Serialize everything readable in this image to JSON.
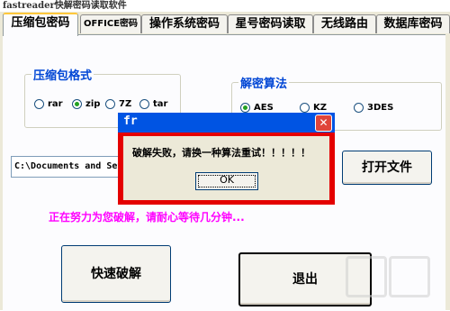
{
  "window": {
    "title": "fastreader快解密码读取软件"
  },
  "tabs": [
    {
      "label": "压缩包密码",
      "active": true
    },
    {
      "label": "OFFICE密码",
      "active": false
    },
    {
      "label": "操作系统密码",
      "active": false
    },
    {
      "label": "星号密码读取",
      "active": false
    },
    {
      "label": "无线路由",
      "active": false
    },
    {
      "label": "数据库密码",
      "active": false
    }
  ],
  "nav_arrows": {
    "left": "◂",
    "right": "▸"
  },
  "format_group": {
    "label": "压缩包格式",
    "options": [
      "rar",
      "zip",
      "7Z",
      "tar"
    ],
    "selected": "zip"
  },
  "algo_group": {
    "label": "解密算法",
    "options": [
      "AES",
      "KZ",
      "3DES"
    ],
    "selected": "AES"
  },
  "path": {
    "value": "C:\\Documents and Setti"
  },
  "buttons": {
    "open_file": "打开文件",
    "fast_crack": "快速破解",
    "exit": "退出"
  },
  "status_text": "正在努力为您破解，请耐心等待几分钟...",
  "dialog": {
    "title": "fr",
    "message": "破解失败，请换一种算法重试！！！！！",
    "ok": "OK",
    "close": "✕"
  },
  "colors": {
    "legend": "#0046d5",
    "status": "#ff00ff",
    "dialog_border": "#e40000",
    "titlebar": "#0054e3"
  }
}
